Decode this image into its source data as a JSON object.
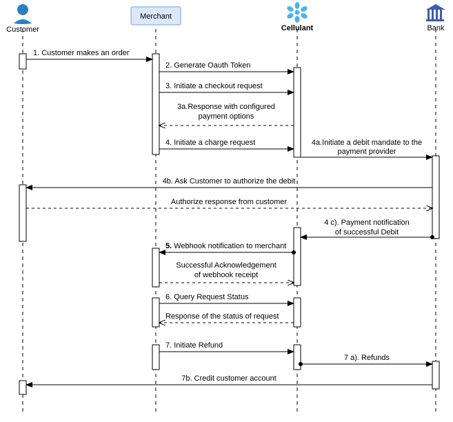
{
  "actors": {
    "customer": "Customer",
    "merchant": "Merchant",
    "cellulant": "Cellulant",
    "bank": "Bank"
  },
  "messages": {
    "m1": "1. Customer makes an order",
    "m2": "2. Generate Oauth Token",
    "m3": "3. Initiate a checkout request",
    "m3a_l1": "3a.Response with configured",
    "m3a_l2": "payment options",
    "m4": "4. Initiate a charge request",
    "m4a_l1": "4a.Initiate a debit mandate  to the",
    "m4a_l2": "payment provider",
    "m4b": "4b. Ask Customer to authorize the debit",
    "m4auth": "Authorize response from customer",
    "m4c_l1": "4 c). Payment notification",
    "m4c_l2": "of successful Debit",
    "m5": "5. Webhook notification to merchant",
    "m5ack_l1": "Successful Acknowledgement",
    "m5ack_l2": "of webhook receipt",
    "m6": "6. Query Request Status",
    "m6r": "Response of the status of request",
    "m7": "7. Initiate Refund",
    "m7a": "7 a). Refunds",
    "m7b": "7b. Credit customer account"
  },
  "chart_data": {
    "type": "sequence",
    "participants": [
      "Customer",
      "Merchant",
      "Cellulant",
      "Bank"
    ],
    "messages": [
      {
        "from": "Customer",
        "to": "Merchant",
        "label": "1. Customer makes an order",
        "style": "solid"
      },
      {
        "from": "Merchant",
        "to": "Cellulant",
        "label": "2. Generate Oauth Token",
        "style": "solid"
      },
      {
        "from": "Merchant",
        "to": "Cellulant",
        "label": "3. Initiate a checkout request",
        "style": "solid"
      },
      {
        "from": "Cellulant",
        "to": "Merchant",
        "label": "3a. Response with configured payment options",
        "style": "dashed"
      },
      {
        "from": "Merchant",
        "to": "Cellulant",
        "label": "4. Initiate a charge request",
        "style": "solid"
      },
      {
        "from": "Cellulant",
        "to": "Bank",
        "label": "4a. Initiate a debit mandate to the payment provider",
        "style": "solid"
      },
      {
        "from": "Bank",
        "to": "Customer",
        "label": "4b. Ask Customer to authorize the debit",
        "style": "solid"
      },
      {
        "from": "Customer",
        "to": "Bank",
        "label": "Authorize response from customer",
        "style": "dashed"
      },
      {
        "from": "Bank",
        "to": "Cellulant",
        "label": "4c. Payment notification of successful Debit",
        "style": "solid"
      },
      {
        "from": "Cellulant",
        "to": "Merchant",
        "label": "5. Webhook notification to merchant",
        "style": "solid"
      },
      {
        "from": "Merchant",
        "to": "Cellulant",
        "label": "Successful Acknowledgement of webhook receipt",
        "style": "dashed"
      },
      {
        "from": "Merchant",
        "to": "Cellulant",
        "label": "6. Query Request Status",
        "style": "solid"
      },
      {
        "from": "Cellulant",
        "to": "Merchant",
        "label": "Response of the status of request",
        "style": "dashed"
      },
      {
        "from": "Merchant",
        "to": "Cellulant",
        "label": "7. Initiate Refund",
        "style": "solid"
      },
      {
        "from": "Cellulant",
        "to": "Bank",
        "label": "7a. Refunds",
        "style": "solid"
      },
      {
        "from": "Bank",
        "to": "Customer",
        "label": "7b. Credit customer account",
        "style": "solid"
      }
    ]
  }
}
